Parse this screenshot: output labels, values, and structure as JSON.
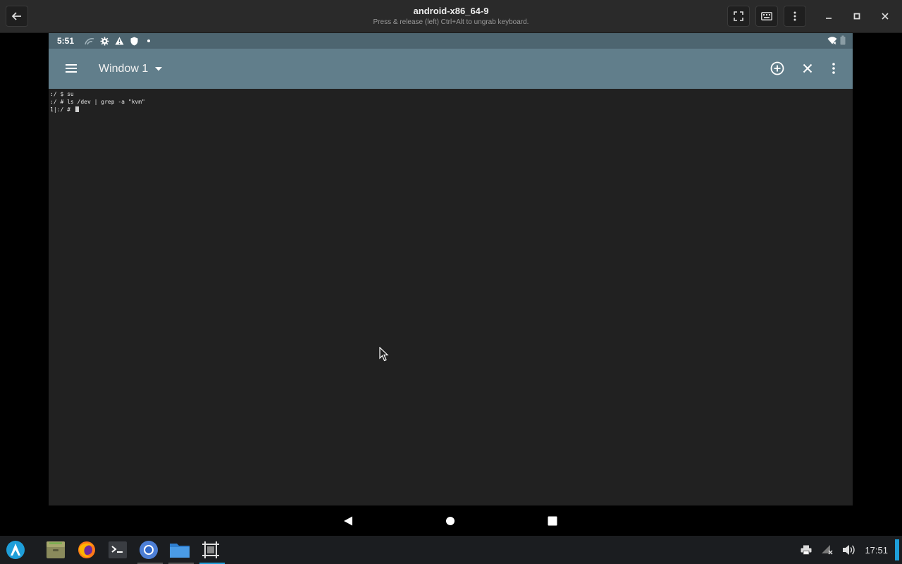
{
  "window": {
    "title": "android-x86_64-9",
    "subtitle": "Press & release (left) Ctrl+Alt to ungrab keyboard."
  },
  "android": {
    "status_time": "5:51",
    "status_icons": [
      "cast-icon",
      "settings-icon",
      "warning-icon",
      "shield-icon",
      "dot-icon"
    ],
    "status_right_icons": [
      "wifi-icon",
      "battery-icon"
    ],
    "appbar": {
      "window_label": "Window 1"
    },
    "terminal_lines": [
      ":/ $ su",
      ":/ # ls /dev | grep -a \"kvm\"",
      "1|:/ # "
    ],
    "nav_buttons": [
      "back",
      "home",
      "recents"
    ]
  },
  "taskbar": {
    "apps": [
      "launcher",
      "files",
      "firefox",
      "terminal",
      "chromium",
      "file-manager",
      "screenshot"
    ],
    "active_app": "screenshot",
    "clock": "17:51"
  },
  "colors": {
    "statusbar": "#4d6570",
    "appbar": "#617e8b",
    "terminal_bg": "#212121",
    "accent": "#1e9ed9"
  }
}
